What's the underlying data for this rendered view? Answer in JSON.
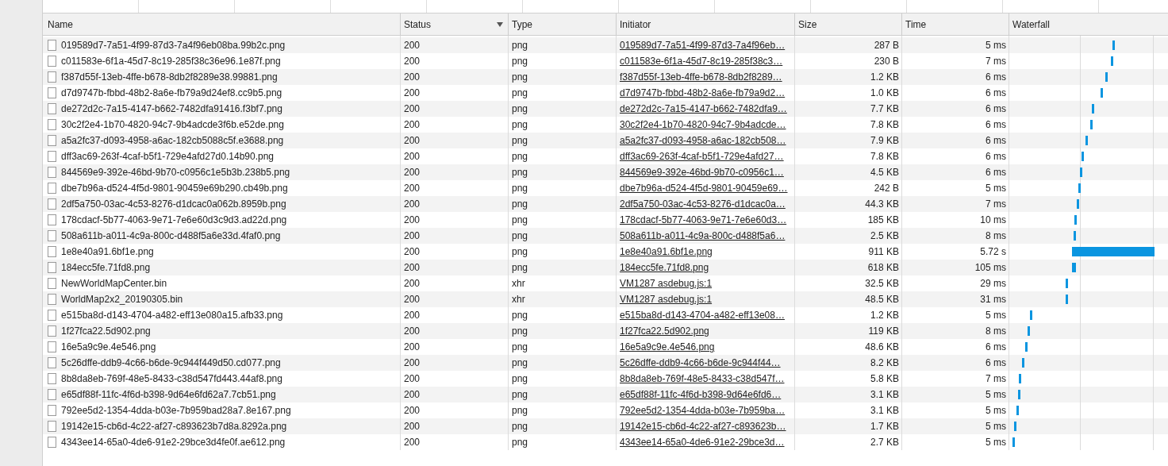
{
  "table": {
    "columns": [
      {
        "label": "Name",
        "sorted": false
      },
      {
        "label": "Status",
        "sorted": true
      },
      {
        "label": "Type",
        "sorted": false
      },
      {
        "label": "Initiator",
        "sorted": false
      },
      {
        "label": "Size",
        "sorted": false
      },
      {
        "label": "Time",
        "sorted": false
      },
      {
        "label": "Waterfall",
        "sorted": false
      }
    ],
    "rows": [
      {
        "name": "019589d7-7a51-4f99-87d3-7a4f96eb08ba.99b2c.png",
        "status": "200",
        "type": "png",
        "initiator": "019589d7-7a51-4f99-87d3-7a4f96eb…",
        "size": "287 B",
        "time": "5 ms"
      },
      {
        "name": "c011583e-6f1a-45d7-8c19-285f38c36e96.1e87f.png",
        "status": "200",
        "type": "png",
        "initiator": "c011583e-6f1a-45d7-8c19-285f38c3…",
        "size": "230 B",
        "time": "7 ms"
      },
      {
        "name": "f387d55f-13eb-4ffe-b678-8db2f8289e38.99881.png",
        "status": "200",
        "type": "png",
        "initiator": "f387d55f-13eb-4ffe-b678-8db2f8289…",
        "size": "1.2 KB",
        "time": "6 ms"
      },
      {
        "name": "d7d9747b-fbbd-48b2-8a6e-fb79a9d24ef8.cc9b5.png",
        "status": "200",
        "type": "png",
        "initiator": "d7d9747b-fbbd-48b2-8a6e-fb79a9d2…",
        "size": "1.0 KB",
        "time": "6 ms"
      },
      {
        "name": "de272d2c-7a15-4147-b662-7482dfa91416.f3bf7.png",
        "status": "200",
        "type": "png",
        "initiator": "de272d2c-7a15-4147-b662-7482dfa9…",
        "size": "7.7 KB",
        "time": "6 ms"
      },
      {
        "name": "30c2f2e4-1b70-4820-94c7-9b4adcde3f6b.e52de.png",
        "status": "200",
        "type": "png",
        "initiator": "30c2f2e4-1b70-4820-94c7-9b4adcde…",
        "size": "7.8 KB",
        "time": "6 ms"
      },
      {
        "name": "a5a2fc37-d093-4958-a6ac-182cb5088c5f.e3688.png",
        "status": "200",
        "type": "png",
        "initiator": "a5a2fc37-d093-4958-a6ac-182cb508…",
        "size": "7.9 KB",
        "time": "6 ms"
      },
      {
        "name": "dff3ac69-263f-4caf-b5f1-729e4afd27d0.14b90.png",
        "status": "200",
        "type": "png",
        "initiator": "dff3ac69-263f-4caf-b5f1-729e4afd27…",
        "size": "7.8 KB",
        "time": "6 ms"
      },
      {
        "name": "844569e9-392e-46bd-9b70-c0956c1e5b3b.238b5.png",
        "status": "200",
        "type": "png",
        "initiator": "844569e9-392e-46bd-9b70-c0956c1…",
        "size": "4.5 KB",
        "time": "6 ms"
      },
      {
        "name": "dbe7b96a-d524-4f5d-9801-90459e69b290.cb49b.png",
        "status": "200",
        "type": "png",
        "initiator": "dbe7b96a-d524-4f5d-9801-90459e69…",
        "size": "242 B",
        "time": "5 ms"
      },
      {
        "name": "2df5a750-03ac-4c53-8276-d1dcac0a062b.8959b.png",
        "status": "200",
        "type": "png",
        "initiator": "2df5a750-03ac-4c53-8276-d1dcac0a…",
        "size": "44.3 KB",
        "time": "7 ms"
      },
      {
        "name": "178cdacf-5b77-4063-9e71-7e6e60d3c9d3.ad22d.png",
        "status": "200",
        "type": "png",
        "initiator": "178cdacf-5b77-4063-9e71-7e6e60d3…",
        "size": "185 KB",
        "time": "10 ms"
      },
      {
        "name": "508a611b-a011-4c9a-800c-d488f5a6e33d.4faf0.png",
        "status": "200",
        "type": "png",
        "initiator": "508a611b-a011-4c9a-800c-d488f5a6…",
        "size": "2.5 KB",
        "time": "8 ms"
      },
      {
        "name": "1e8e40a91.6bf1e.png",
        "status": "200",
        "type": "png",
        "initiator": "1e8e40a91.6bf1e.png",
        "size": "911 KB",
        "time": "5.72 s"
      },
      {
        "name": "184ecc5fe.71fd8.png",
        "status": "200",
        "type": "png",
        "initiator": "184ecc5fe.71fd8.png",
        "size": "618 KB",
        "time": "105 ms"
      },
      {
        "name": "NewWorldMapCenter.bin",
        "status": "200",
        "type": "xhr",
        "initiator": "VM1287 asdebug.js:1",
        "size": "32.5 KB",
        "time": "29 ms"
      },
      {
        "name": "WorldMap2x2_20190305.bin",
        "status": "200",
        "type": "xhr",
        "initiator": "VM1287 asdebug.js:1",
        "size": "48.5 KB",
        "time": "31 ms"
      },
      {
        "name": "e515ba8d-d143-4704-a482-eff13e080a15.afb33.png",
        "status": "200",
        "type": "png",
        "initiator": "e515ba8d-d143-4704-a482-eff13e08…",
        "size": "1.2 KB",
        "time": "5 ms"
      },
      {
        "name": "1f27fca22.5d902.png",
        "status": "200",
        "type": "png",
        "initiator": "1f27fca22.5d902.png",
        "size": "119 KB",
        "time": "8 ms"
      },
      {
        "name": "16e5a9c9e.4e546.png",
        "status": "200",
        "type": "png",
        "initiator": "16e5a9c9e.4e546.png",
        "size": "48.6 KB",
        "time": "6 ms"
      },
      {
        "name": "5c26dffe-ddb9-4c66-b6de-9c944f449d50.cd077.png",
        "status": "200",
        "type": "png",
        "initiator": "5c26dffe-ddb9-4c66-b6de-9c944f44…",
        "size": "8.2 KB",
        "time": "6 ms"
      },
      {
        "name": "8b8da8eb-769f-48e5-8433-c38d547fd443.44af8.png",
        "status": "200",
        "type": "png",
        "initiator": "8b8da8eb-769f-48e5-8433-c38d547f…",
        "size": "5.8 KB",
        "time": "7 ms"
      },
      {
        "name": "e65df88f-11fc-4f6d-b398-9d64e6fd62a7.7cb51.png",
        "status": "200",
        "type": "png",
        "initiator": "e65df88f-11fc-4f6d-b398-9d64e6fd6…",
        "size": "3.1 KB",
        "time": "5 ms"
      },
      {
        "name": "792ee5d2-1354-4dda-b03e-7b959bad28a7.8e167.png",
        "status": "200",
        "type": "png",
        "initiator": "792ee5d2-1354-4dda-b03e-7b959ba…",
        "size": "3.1 KB",
        "time": "5 ms"
      },
      {
        "name": "19142e15-cb6d-4c22-af27-c893623b7d8a.8292a.png",
        "status": "200",
        "type": "png",
        "initiator": "19142e15-cb6d-4c22-af27-c893623b…",
        "size": "1.7 KB",
        "time": "5 ms"
      },
      {
        "name": "4343ee14-65a0-4de6-91e2-29bce3d4fe0f.ae612.png",
        "status": "200",
        "type": "png",
        "initiator": "4343ee14-65a0-4de6-91e2-29bce3d…",
        "size": "2.7 KB",
        "time": "5 ms"
      }
    ]
  }
}
